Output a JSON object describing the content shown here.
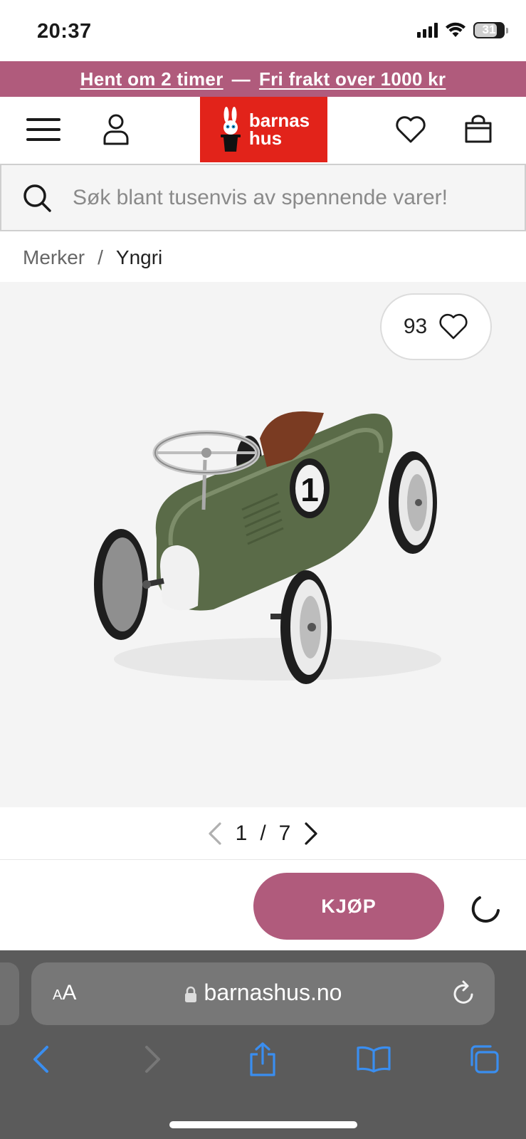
{
  "status_bar": {
    "time": "20:37",
    "battery_level": "31",
    "icons": [
      "cellular-signal-icon",
      "wifi-icon",
      "battery-icon"
    ]
  },
  "promo": {
    "pickup_text": "Hent om 2 timer",
    "separator": "—",
    "shipping_text": "Fri frakt over 1000 kr",
    "background": "#b05b7c"
  },
  "header": {
    "icons": [
      "menu-icon",
      "account-icon",
      "wishlist-heart-icon",
      "shopping-bag-icon"
    ],
    "logo": {
      "line1": "barnas",
      "line2": "hus",
      "background": "#e2231a"
    }
  },
  "search": {
    "placeholder": "Søk blant tusenvis av spennende varer!"
  },
  "breadcrumb": {
    "items": [
      "Merker",
      "Yngri"
    ],
    "separator": "/"
  },
  "product": {
    "like_count": "93",
    "image_description_icon": "ride-on-race-car-image",
    "car_number": "1",
    "colors": {
      "body": "#5a6b48",
      "seat": "#7a3b22"
    }
  },
  "pager": {
    "current": "1",
    "separator": "/",
    "total": "7"
  },
  "buy": {
    "label": "KJØP",
    "accent": "#b05b7c"
  },
  "browser": {
    "text_size_label_small": "A",
    "text_size_label_large": "A",
    "url": "barnashus.no",
    "toolbar_icons": [
      "back-icon",
      "forward-icon",
      "share-icon",
      "bookmarks-icon",
      "tabs-icon"
    ],
    "accent": "#3a8ef0"
  }
}
